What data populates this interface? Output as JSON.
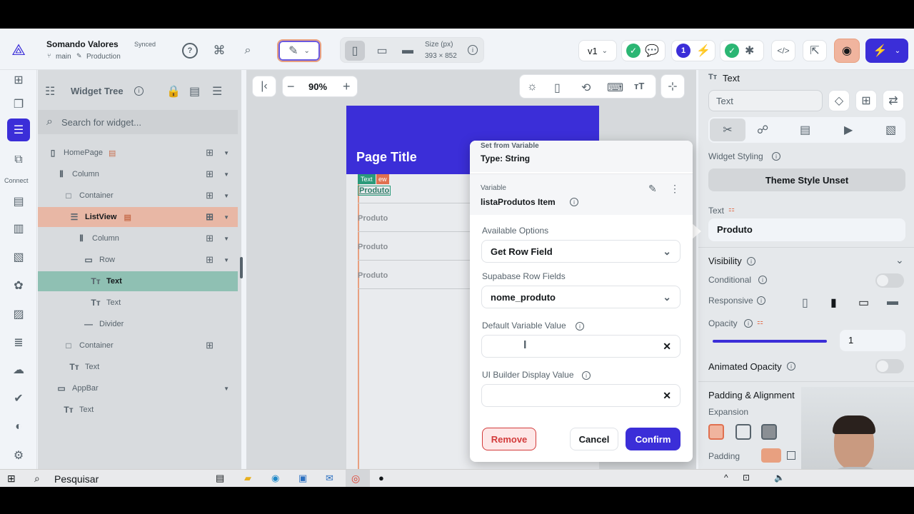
{
  "project": {
    "name": "Somando Valores",
    "sync_status": "Synced",
    "branch": "main",
    "environment": "Production"
  },
  "device": {
    "size_label": "Size (px)",
    "size_value": "393 × 852"
  },
  "version": "v1",
  "badge_count": "1",
  "widget_tree": {
    "title": "Widget Tree",
    "search_placeholder": "Search for widget...",
    "items": [
      {
        "label": "HomePage"
      },
      {
        "label": "Column"
      },
      {
        "label": "Container"
      },
      {
        "label": "ListView"
      },
      {
        "label": "Column"
      },
      {
        "label": "Row"
      },
      {
        "label": "Text"
      },
      {
        "label": "Text"
      },
      {
        "label": "Divider"
      },
      {
        "label": "Container"
      },
      {
        "label": "Text"
      },
      {
        "label": "AppBar"
      },
      {
        "label": "Text"
      }
    ]
  },
  "rail": {
    "connect_label": "Connect"
  },
  "canvas": {
    "zoom": "90%",
    "page_title": "Page Title",
    "text_tag": "Text",
    "listview_tag": "ew",
    "list_items": [
      "Produto",
      "Produto",
      "Produto",
      "Produto"
    ]
  },
  "modal": {
    "header_title": "Set from Variable",
    "header_type": "Type: String",
    "variable_label": "Variable",
    "variable_value": "listaProdutos Item",
    "available_options_label": "Available Options",
    "available_options_value": "Get Row Field",
    "supabase_label": "Supabase Row Fields",
    "supabase_value": "nome_produto",
    "default_label": "Default Variable Value",
    "default_value": "",
    "display_label": "UI Builder Display Value",
    "display_value": "",
    "remove_button": "Remove",
    "cancel_button": "Cancel",
    "confirm_button": "Confirm"
  },
  "properties": {
    "widget_type": "Text",
    "widget_name": "Text",
    "widget_styling_label": "Widget Styling",
    "theme_style_button": "Theme Style Unset",
    "text_label": "Text",
    "text_value": "Produto",
    "visibility_label": "Visibility",
    "conditional_label": "Conditional",
    "responsive_label": "Responsive",
    "opacity_label": "Opacity",
    "opacity_value": "1",
    "opacity_level": 1,
    "animated_opacity_label": "Animated Opacity",
    "padding_alignment_label": "Padding & Alignment",
    "expansion_label": "Expansion",
    "padding_label": "Padding"
  },
  "taskbar": {
    "search_placeholder": "Pesquisar"
  },
  "colors": {
    "accent": "#3b2ed8",
    "listview_highlight": "#e8b7a5",
    "selected_text_row": "#8fc0b3",
    "confirm": "#3b2ed8",
    "remove_bg": "#fde7e7",
    "remove_text": "#d33b3b"
  }
}
